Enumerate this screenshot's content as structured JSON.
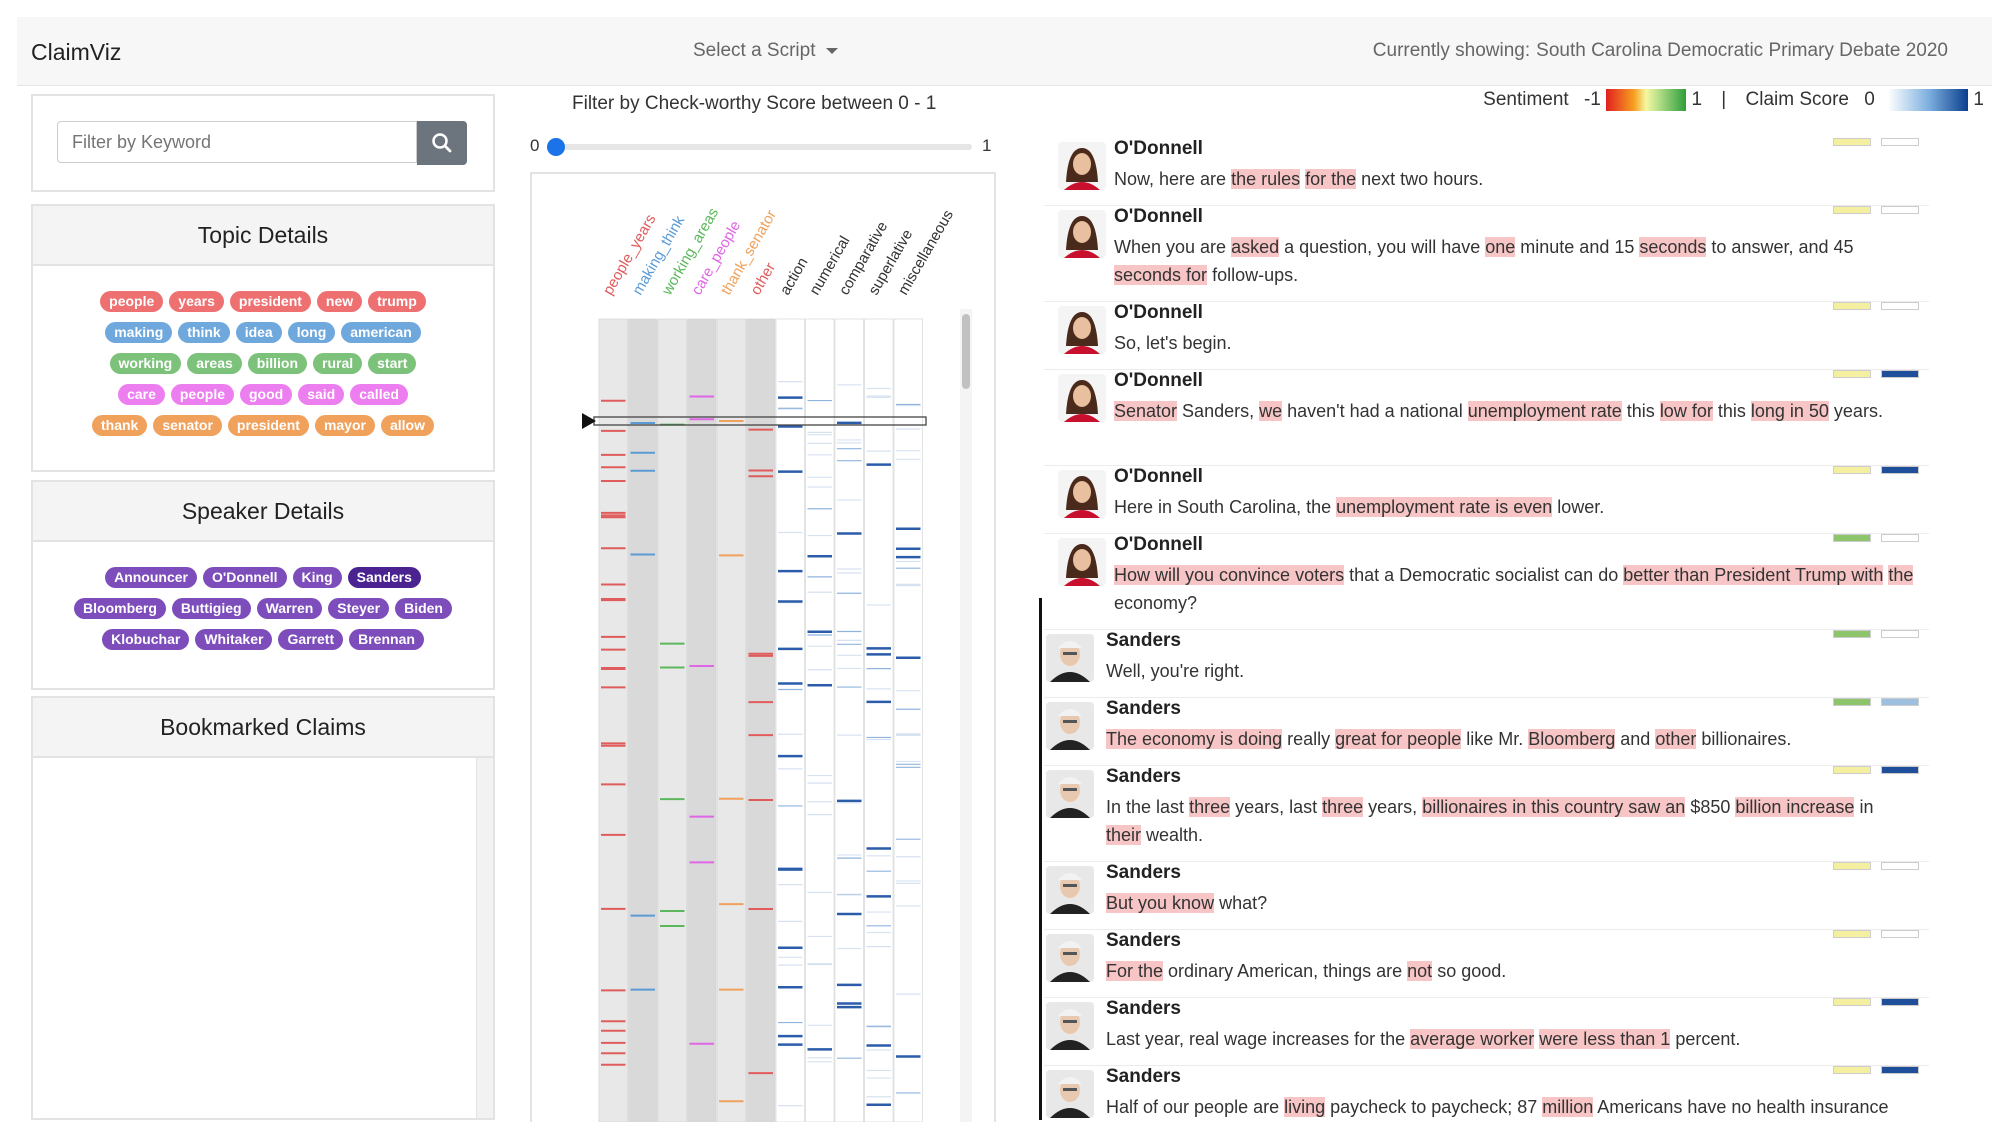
{
  "app": {
    "title": "ClaimViz"
  },
  "nav": {
    "script_select": "Select a Script",
    "showing_prefix": "Currently showing:",
    "showing": "South Carolina Democratic Primary Debate 2020"
  },
  "search": {
    "placeholder": "Filter by Keyword"
  },
  "topic_details": {
    "title": "Topic Details",
    "rows": [
      {
        "color": "red",
        "tags": [
          "people",
          "years",
          "president",
          "new",
          "trump"
        ]
      },
      {
        "color": "blue",
        "tags": [
          "making",
          "think",
          "idea",
          "long",
          "american"
        ]
      },
      {
        "color": "green",
        "tags": [
          "working",
          "areas",
          "billion",
          "rural",
          "start"
        ]
      },
      {
        "color": "pink",
        "tags": [
          "care",
          "people",
          "good",
          "said",
          "called"
        ]
      },
      {
        "color": "orange",
        "tags": [
          "thank",
          "senator",
          "president",
          "mayor",
          "allow"
        ]
      }
    ]
  },
  "speaker_details": {
    "title": "Speaker Details",
    "rows": [
      [
        "Announcer",
        "O'Donnell",
        "King",
        "Sanders"
      ],
      [
        "Bloomberg",
        "Buttigieg",
        "Warren",
        "Steyer",
        "Biden"
      ],
      [
        "Klobuchar",
        "Whitaker",
        "Garrett",
        "Brennan"
      ]
    ],
    "selected": "Sanders"
  },
  "bookmarks": {
    "title": "Bookmarked Claims"
  },
  "filter": {
    "label": "Filter by Check-worthy Score between 0 - 1",
    "min_label": "0",
    "max_label": "1",
    "value": 0
  },
  "legend": {
    "sentiment_label": "Sentiment",
    "sentiment_min": "-1",
    "sentiment_max": "1",
    "separator": "|",
    "claim_label": "Claim Score",
    "claim_min": "0",
    "claim_max": "1"
  },
  "matrix": {
    "columns": [
      {
        "label": "people_years",
        "color": "#e05c5c"
      },
      {
        "label": "making_think",
        "color": "#5b9bd5"
      },
      {
        "label": "working_areas",
        "color": "#5cb85c"
      },
      {
        "label": "care_people",
        "color": "#e066e6"
      },
      {
        "label": "thank_senator",
        "color": "#f0a15c"
      },
      {
        "label": "other",
        "color": "#e05c5c"
      },
      {
        "label": "action",
        "color": "#333333"
      },
      {
        "label": "numerical",
        "color": "#333333"
      },
      {
        "label": "comparative",
        "color": "#333333"
      },
      {
        "label": "superlative",
        "color": "#333333"
      },
      {
        "label": "miscellaneous",
        "color": "#333333"
      }
    ]
  },
  "transcript": [
    {
      "speaker": "O'Donnell",
      "text": "Now, here are [the rules] [for the] next two hours.",
      "sentiment": "yellow",
      "claim": "empty"
    },
    {
      "speaker": "O'Donnell",
      "text": "When you are [asked] a question, you will have [one] minute and 15 [seconds] to answer, and 45 [seconds for] follow-ups.",
      "sentiment": "yellow",
      "claim": "empty"
    },
    {
      "speaker": "O'Donnell",
      "text": "So, let's begin.",
      "sentiment": "yellow",
      "claim": "empty"
    },
    {
      "speaker": "O'Donnell",
      "text": "[Senator] Sanders, [we] haven't had a national [unemployment rate] this [low for] this [long in 50] years.",
      "sentiment": "yellow",
      "claim": "dark"
    },
    {
      "speaker": "O'Donnell",
      "text": "Here in South Carolina, the [unemployment rate is even] lower.",
      "sentiment": "yellow",
      "claim": "dark"
    },
    {
      "speaker": "O'Donnell",
      "text": "[How will you convince voters] that a Democratic socialist can do [better than President Trump with] [the] economy?",
      "sentiment": "green",
      "claim": "empty"
    },
    {
      "speaker": "Sanders",
      "text": "Well, you're right.",
      "sentiment": "green",
      "claim": "empty"
    },
    {
      "speaker": "Sanders",
      "text": "[The economy is doing] really [great for people] like Mr. [Bloomberg] and [other] billionaires.",
      "sentiment": "green",
      "claim": "light"
    },
    {
      "speaker": "Sanders",
      "text": "In the last [three] years, last [three] years, [billionaires in this country saw an] $850 [billion increase] in [their] wealth.",
      "sentiment": "yellow",
      "claim": "dark"
    },
    {
      "speaker": "Sanders",
      "text": "[But you know] what?",
      "sentiment": "yellow",
      "claim": "empty"
    },
    {
      "speaker": "Sanders",
      "text": "[For the] ordinary American, things are [not] so good.",
      "sentiment": "yellow",
      "claim": "empty"
    },
    {
      "speaker": "Sanders",
      "text": "Last year, real wage increases for the [average worker] [were less than 1] percent.",
      "sentiment": "yellow",
      "claim": "dark"
    },
    {
      "speaker": "Sanders",
      "text": "Half of our people are [living] paycheck to paycheck; 87 [million] Americans have no health insurance",
      "sentiment": "yellow",
      "claim": "dark"
    }
  ],
  "colors": {
    "sentiment": {
      "yellow": "#f5f0a0",
      "green": "#8cc56b"
    },
    "claim": {
      "empty": "#ffffff",
      "light": "#9ec0e0",
      "dark": "#1f4f9a"
    }
  }
}
